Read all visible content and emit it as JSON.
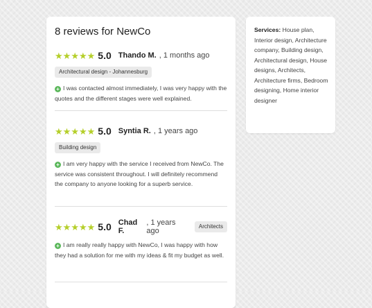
{
  "reviews_title": "8 reviews for NewCo",
  "reviews": [
    {
      "rating": "5.0",
      "name": "Thando M.",
      "time": ", 1 months ago",
      "tag": "Architectural design - Johannesburg",
      "text": "I was contacted almost immediately, I was very happy with the quotes and the different stages were well explained."
    },
    {
      "rating": "5.0",
      "name": "Syntia R.",
      "time": ", 1 years ago",
      "tag": "Building design",
      "text": "I am very happy with the service I received from NewCo. The service was consistent throughout. I will definitely recommend the company to anyone looking for a superb service."
    },
    {
      "rating": "5.0",
      "name": "Chad F.",
      "time": ", 1 years ago",
      "tag": "Architects",
      "text": "I am really really happy with NewCo, I was happy with how they had a solution for me with my ideas & fit my budget as well."
    }
  ],
  "services": {
    "label": "Services:",
    "list": " House plan, Interior design, Architecture company, Building design, Architectural design, House designs, Architects, Architecture firms, Bedroom designing, Home interior designer"
  },
  "colors": {
    "star": "#b5cf2a",
    "check": "#5cb85c"
  },
  "icons": {
    "star": "star-icon",
    "check": "plus-circle-icon"
  }
}
